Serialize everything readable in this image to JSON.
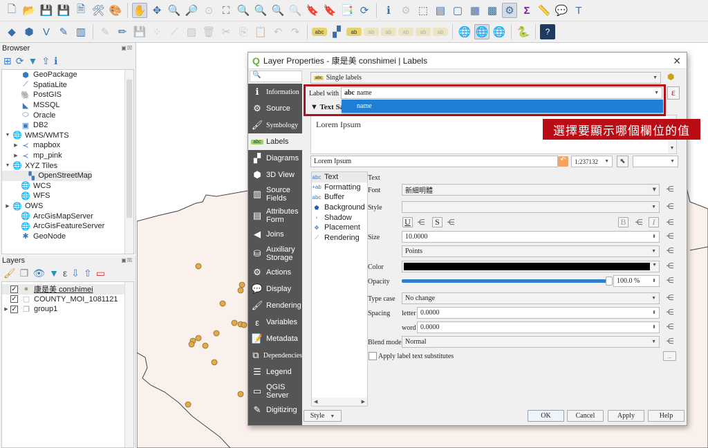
{
  "toolbar1": {
    "items": [
      {
        "icon": "new-project-icon",
        "glyph": "🗋"
      },
      {
        "icon": "open-project-icon",
        "glyph": "📂"
      },
      {
        "icon": "save-project-icon",
        "glyph": "💾"
      },
      {
        "icon": "save-as-icon",
        "glyph": "💾"
      },
      {
        "icon": "new-print-layout-icon",
        "glyph": "🗎"
      },
      {
        "icon": "layout-manager-icon",
        "glyph": "🛠"
      },
      {
        "icon": "style-manager-icon",
        "glyph": "🎨"
      },
      {
        "icon": "pan-icon",
        "glyph": "✋"
      },
      {
        "icon": "pan-to-selection-icon",
        "glyph": "✥"
      },
      {
        "icon": "zoom-in-icon",
        "glyph": "🔍"
      },
      {
        "icon": "zoom-out-icon",
        "glyph": "🔎"
      },
      {
        "icon": "zoom-native-icon",
        "glyph": "⊙"
      },
      {
        "icon": "zoom-full-icon",
        "glyph": "⛶"
      },
      {
        "icon": "zoom-selection-icon",
        "glyph": "🔍"
      },
      {
        "icon": "zoom-layer-icon",
        "glyph": "🔍"
      },
      {
        "icon": "zoom-last-icon",
        "glyph": "🔍"
      },
      {
        "icon": "zoom-next-icon",
        "glyph": "🔍"
      },
      {
        "icon": "new-bookmark-icon",
        "glyph": "🔖"
      },
      {
        "icon": "show-bookmarks-icon",
        "glyph": "🔖"
      },
      {
        "icon": "spatial-bookmarks-icon",
        "glyph": "📑"
      },
      {
        "icon": "refresh-icon",
        "glyph": "⟳"
      },
      {
        "icon": "identify-icon",
        "glyph": "ℹ"
      },
      {
        "icon": "run-action-icon",
        "glyph": "⚙"
      },
      {
        "icon": "select-features-icon",
        "glyph": "⬚"
      },
      {
        "icon": "select-by-value-icon",
        "glyph": "▤"
      },
      {
        "icon": "deselect-icon",
        "glyph": "▢"
      },
      {
        "icon": "attribute-table-icon",
        "glyph": "▦"
      },
      {
        "icon": "field-calculator-icon",
        "glyph": "▩"
      },
      {
        "icon": "processing-toolbox-icon",
        "glyph": "⚙"
      },
      {
        "icon": "statistical-summary-icon",
        "glyph": "Σ"
      },
      {
        "icon": "measure-icon",
        "glyph": "📏"
      },
      {
        "icon": "map-tips-icon",
        "glyph": "💬"
      },
      {
        "icon": "text-annotation-icon",
        "glyph": "T"
      }
    ]
  },
  "toolbar2": {
    "items": [
      {
        "icon": "data-source-manager-icon",
        "glyph": "◆"
      },
      {
        "icon": "new-geopackage-layer-icon",
        "glyph": "⬢"
      },
      {
        "icon": "new-shapefile-layer-icon",
        "glyph": "V"
      },
      {
        "icon": "new-spatialite-layer-icon",
        "glyph": "✎"
      },
      {
        "icon": "new-temporary-layer-icon",
        "glyph": "▥"
      },
      {
        "icon": "current-edits-icon",
        "glyph": "✎"
      },
      {
        "icon": "toggle-editing-icon",
        "glyph": "✏"
      },
      {
        "icon": "save-edits-icon",
        "glyph": "💾"
      },
      {
        "icon": "add-point-icon",
        "glyph": "⁘"
      },
      {
        "icon": "vertex-tool-icon",
        "glyph": "⟋"
      },
      {
        "icon": "modify-attributes-icon",
        "glyph": "▨"
      },
      {
        "icon": "delete-selected-icon",
        "glyph": "🗑"
      },
      {
        "icon": "cut-features-icon",
        "glyph": "✂"
      },
      {
        "icon": "copy-features-icon",
        "glyph": "⎘"
      },
      {
        "icon": "paste-features-icon",
        "glyph": "📋"
      },
      {
        "icon": "undo-icon",
        "glyph": "↶"
      },
      {
        "icon": "redo-icon",
        "glyph": "↷"
      },
      {
        "icon": "layer-labeling-icon",
        "glyph": "abc"
      },
      {
        "icon": "layer-diagram-icon",
        "glyph": "▞"
      },
      {
        "icon": "pin-labels-icon",
        "glyph": "ab"
      },
      {
        "icon": "highlight-pinned-icon",
        "glyph": "ab"
      },
      {
        "icon": "show-hide-labels-icon",
        "glyph": "ab"
      },
      {
        "icon": "move-label-icon",
        "glyph": "ab"
      },
      {
        "icon": "rotate-label-icon",
        "glyph": "ab"
      },
      {
        "icon": "change-label-icon",
        "glyph": "ab"
      },
      {
        "icon": "metasearch-icon",
        "glyph": "🌐"
      },
      {
        "icon": "metasearch-active-icon",
        "glyph": "🌐"
      },
      {
        "icon": "geocoder-icon",
        "glyph": "🌐"
      },
      {
        "icon": "python-console-icon",
        "glyph": "🐍"
      },
      {
        "icon": "help-icon",
        "glyph": "?"
      }
    ]
  },
  "browser": {
    "title": "Browser",
    "items": [
      {
        "label": "GeoPackage",
        "icon": "geopackage-icon",
        "glyph": "⬢",
        "indent": 1,
        "arrow": ""
      },
      {
        "label": "SpatiaLite",
        "icon": "spatialite-icon",
        "glyph": "⟋",
        "indent": 1,
        "arrow": ""
      },
      {
        "label": "PostGIS",
        "icon": "postgis-icon",
        "glyph": "🐘",
        "indent": 1,
        "arrow": ""
      },
      {
        "label": "MSSQL",
        "icon": "mssql-icon",
        "glyph": "◣",
        "indent": 1,
        "arrow": ""
      },
      {
        "label": "Oracle",
        "icon": "oracle-icon",
        "glyph": "⬭",
        "indent": 1,
        "arrow": ""
      },
      {
        "label": "DB2",
        "icon": "db2-icon",
        "glyph": "▣",
        "indent": 1,
        "arrow": ""
      },
      {
        "label": "WMS/WMTS",
        "icon": "wms-icon",
        "glyph": "🌐",
        "indent": 0,
        "arrow": "▼"
      },
      {
        "label": "mapbox",
        "icon": "connection-icon",
        "glyph": "≺",
        "indent": 1,
        "arrow": "▶"
      },
      {
        "label": "mp_pink",
        "icon": "connection-icon",
        "glyph": "≺",
        "indent": 1,
        "arrow": "▶"
      },
      {
        "label": "XYZ Tiles",
        "icon": "xyz-tiles-icon",
        "glyph": "🌐",
        "indent": 0,
        "arrow": "▼"
      },
      {
        "label": "OpenStreetMap",
        "icon": "tile-layer-icon",
        "glyph": "▚",
        "indent": 2,
        "arrow": "",
        "selected": true
      },
      {
        "label": "WCS",
        "icon": "wcs-icon",
        "glyph": "🌐",
        "indent": 1,
        "arrow": ""
      },
      {
        "label": "WFS",
        "icon": "wfs-icon",
        "glyph": "🌐",
        "indent": 1,
        "arrow": ""
      },
      {
        "label": "OWS",
        "icon": "ows-icon",
        "glyph": "🌐",
        "indent": 0,
        "arrow": "▶"
      },
      {
        "label": "ArcGisMapServer",
        "icon": "arcgis-map-icon",
        "glyph": "🌐",
        "indent": 1,
        "arrow": ""
      },
      {
        "label": "ArcGisFeatureServer",
        "icon": "arcgis-feature-icon",
        "glyph": "🌐",
        "indent": 1,
        "arrow": ""
      },
      {
        "label": "GeoNode",
        "icon": "geonode-icon",
        "glyph": "✱",
        "indent": 1,
        "arrow": ""
      }
    ]
  },
  "layers": {
    "title": "Layers",
    "items": [
      {
        "label": "康是美 conshimei",
        "checked": true,
        "icon": "point-layer-icon",
        "glyph": "●",
        "arrow": "",
        "selected": true
      },
      {
        "label": "COUNTY_MOI_1081121",
        "checked": true,
        "icon": "polygon-layer-icon",
        "glyph": "▢",
        "arrow": ""
      },
      {
        "label": "group1",
        "checked": true,
        "icon": "group-icon",
        "glyph": "❐",
        "arrow": "▶"
      }
    ]
  },
  "dialog": {
    "title": "Layer Properties - 康是美 conshimei | Labels",
    "search_placeholder": "",
    "sidebar": [
      {
        "label": "Information",
        "icon": "information-icon",
        "glyph": "ℹ",
        "serif": true
      },
      {
        "label": "Source",
        "icon": "source-icon",
        "glyph": "⚙"
      },
      {
        "label": "Symbology",
        "icon": "symbology-icon",
        "glyph": "🖌",
        "serif": true
      },
      {
        "label": "Labels",
        "icon": "labels-icon",
        "glyph": "abc",
        "active": true
      },
      {
        "label": "Diagrams",
        "icon": "diagrams-icon",
        "glyph": "▞"
      },
      {
        "label": "3D View",
        "icon": "3d-view-icon",
        "glyph": "⬢"
      },
      {
        "label": "Source\nFields",
        "icon": "source-fields-icon",
        "glyph": "▥",
        "two": true
      },
      {
        "label": "Attributes\nForm",
        "icon": "attributes-form-icon",
        "glyph": "▤",
        "two": true
      },
      {
        "label": "Joins",
        "icon": "joins-icon",
        "glyph": "◀"
      },
      {
        "label": "Auxiliary\nStorage",
        "icon": "auxiliary-storage-icon",
        "glyph": "⛁",
        "two": true
      },
      {
        "label": "Actions",
        "icon": "actions-icon",
        "glyph": "⚙"
      },
      {
        "label": "Display",
        "icon": "display-icon",
        "glyph": "💬"
      },
      {
        "label": "Rendering",
        "icon": "rendering-icon",
        "glyph": "🖌"
      },
      {
        "label": "Variables",
        "icon": "variables-icon",
        "glyph": "ε"
      },
      {
        "label": "Metadata",
        "icon": "metadata-icon",
        "glyph": "📝"
      },
      {
        "label": "Dependencies",
        "icon": "dependencies-icon",
        "glyph": "⧉",
        "serif": true
      },
      {
        "label": "Legend",
        "icon": "legend-icon",
        "glyph": "☰"
      },
      {
        "label": "QGIS\nServer",
        "icon": "qgis-server-icon",
        "glyph": "▭",
        "two": true
      },
      {
        "label": "Digitizing",
        "icon": "digitizing-icon",
        "glyph": "✎"
      }
    ],
    "mode": "Single labels",
    "label_with_label": "Label with",
    "label_with_value": "name",
    "label_with_prefix": "abc",
    "popup_option": "name",
    "text_sample_label": "Text Sample",
    "preview_text": "Lorem Ipsum",
    "preview_input": "Lorem Ipsum",
    "scale": "1:237132",
    "callout": "選擇要顯示哪個欄位的值",
    "subtabs": [
      {
        "label": "Text",
        "icon": "text-icon",
        "glyph": "abc",
        "selected": true
      },
      {
        "label": "Formatting",
        "icon": "formatting-icon",
        "glyph": "+ab"
      },
      {
        "label": "Buffer",
        "icon": "buffer-icon",
        "glyph": "abc"
      },
      {
        "label": "Background",
        "icon": "background-icon",
        "glyph": "⬟"
      },
      {
        "label": "Shadow",
        "icon": "shadow-icon",
        "glyph": "◗"
      },
      {
        "label": "Placement",
        "icon": "placement-icon",
        "glyph": "✥"
      },
      {
        "label": "Rendering",
        "icon": "rendering-sub-icon",
        "glyph": "⟋"
      }
    ],
    "text": {
      "section_title": "Text",
      "font_label": "Font",
      "font_value": "新細明體",
      "style_label": "Style",
      "style_value": "",
      "underline": "U",
      "strike": "S",
      "bold": "B",
      "italic": "I",
      "size_label": "Size",
      "size_value": "10.0000",
      "unit_value": "Points",
      "color_label": "Color",
      "color_value": "#000000",
      "opacity_label": "Opacity",
      "opacity_value": "100.0 %",
      "opacity_fraction": 1.0,
      "typecase_label": "Type case",
      "typecase_value": "No change",
      "spacing_label": "Spacing",
      "letter_label": "letter",
      "letter_value": "0.0000",
      "word_label": "word",
      "word_value": "0.0000",
      "blend_label": "Blend mode",
      "blend_value": "Normal",
      "substitutes_label": "Apply label text substitutes",
      "substitutes_checked": false,
      "more_button": "..."
    },
    "buttons": {
      "style": "Style",
      "ok": "OK",
      "cancel": "Cancel",
      "apply": "Apply",
      "help": "Help"
    }
  },
  "map": {
    "land_color": "#fbf1ec",
    "point_color": "#e3a94b"
  }
}
